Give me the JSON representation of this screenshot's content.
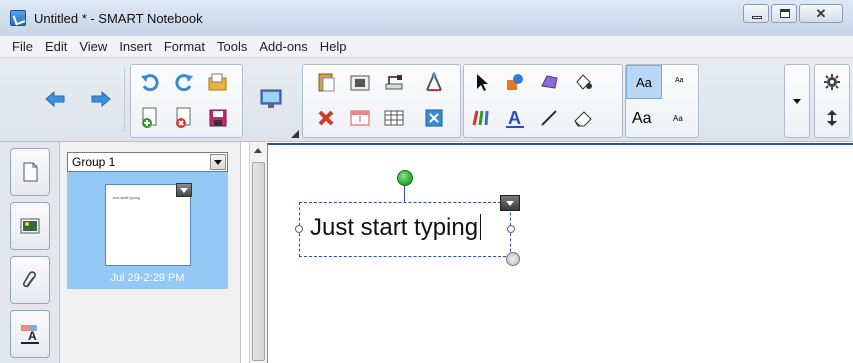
{
  "window": {
    "title": "Untitled * - SMART Notebook",
    "minimize_label": "",
    "maximize_label": "",
    "close_glyph": "✕"
  },
  "menu": [
    "File",
    "Edit",
    "View",
    "Insert",
    "Format",
    "Tools",
    "Add-ons",
    "Help"
  ],
  "toolbar": {
    "icons": [
      "back-arrow-icon",
      "forward-arrow-icon",
      "undo-icon",
      "redo-icon",
      "open-file-icon",
      "new-page-icon",
      "delete-page-icon",
      "save-icon",
      "display-icon",
      "paste-icon",
      "screen-capture-icon",
      "table-icon",
      "delete-icon",
      "screen-shade-icon",
      "insert-table-icon",
      "measurement-tools-icon",
      "select-icon",
      "shapes-icon",
      "polygon-icon",
      "fill-icon",
      "pens-icon",
      "text-icon",
      "lines-icon",
      "eraser-icon"
    ],
    "text_styles": {
      "large_1": "Aa",
      "small_1": "Aa",
      "large_2": "Aa",
      "small_2": "Aa"
    },
    "accent_color": "#2b4dbd"
  },
  "sorter": {
    "group_label": "Group 1",
    "page_date": "Jul 29-2:29 PM",
    "thumb_text": "Just start typing"
  },
  "canvas": {
    "textbox_text": "Just start typing"
  }
}
